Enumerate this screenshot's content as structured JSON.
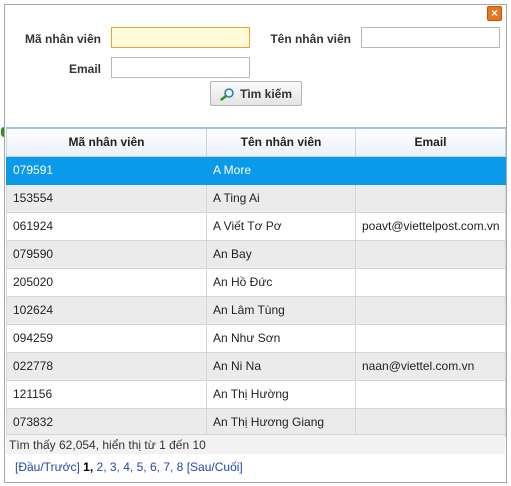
{
  "form": {
    "ma_label": "Mã nhân viên",
    "ma_value": "",
    "ten_label": "Tên nhân viên",
    "ten_value": "",
    "email_label": "Email",
    "email_value": "",
    "search_label": "Tìm kiếm"
  },
  "table": {
    "headers": [
      "Mã nhân viên",
      "Tên nhân viên",
      "Email"
    ],
    "rows": [
      {
        "ma": "079591",
        "ten": "A More",
        "email": ""
      },
      {
        "ma": "153554",
        "ten": "A Ting Ai",
        "email": ""
      },
      {
        "ma": "061924",
        "ten": "A Viết Tơ Pơ",
        "email": "poavt@viettelpost.com.vn"
      },
      {
        "ma": "079590",
        "ten": "An Bay",
        "email": ""
      },
      {
        "ma": "205020",
        "ten": "An Hồ Đức",
        "email": ""
      },
      {
        "ma": "102624",
        "ten": "An Lâm Tùng",
        "email": ""
      },
      {
        "ma": "094259",
        "ten": "An Như Sơn",
        "email": ""
      },
      {
        "ma": "022778",
        "ten": "An Ni Na",
        "email": "naan@viettel.com.vn"
      },
      {
        "ma": "121156",
        "ten": "An Thị Hường",
        "email": ""
      },
      {
        "ma": "073832",
        "ten": "An Thị Hương Giang",
        "email": ""
      }
    ],
    "selected_index": 0
  },
  "status_text": "Tìm thấy 62,054, hiển thị từ 1 đến 10",
  "pager": {
    "first_prev": "[Đầu/Trước]",
    "current": "1,",
    "pages": [
      "2,",
      "3,",
      "4,",
      "5,",
      "6,",
      "7,",
      "8"
    ],
    "next_last": "[Sau/Cuối]"
  },
  "colors": {
    "selected_row": "#0a9aea",
    "alt_row": "#ebebeb",
    "close_button": "#e9741d",
    "link": "#1f4aa8"
  },
  "icons": {
    "close": "close-icon",
    "search": "magnifier-icon"
  }
}
